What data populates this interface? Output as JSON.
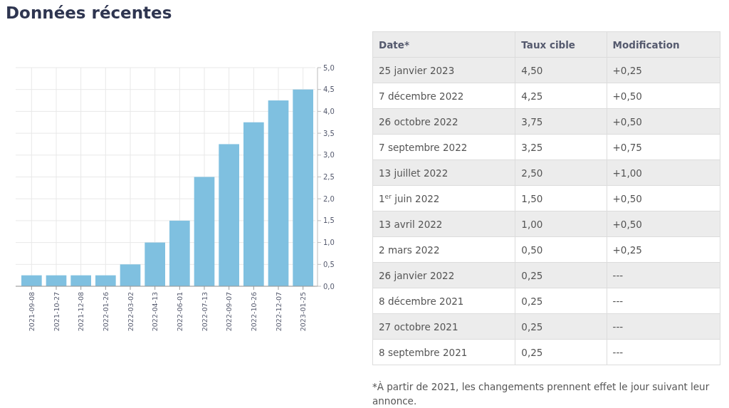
{
  "title": "Données récentes",
  "chart": {
    "chart_data": {
      "type": "bar",
      "categories": [
        "2021-09-08",
        "2021-10-27",
        "2021-12-08",
        "2022-01-26",
        "2022-03-02",
        "2022-04-13",
        "2022-06-01",
        "2022-07-13",
        "2022-09-07",
        "2022-10-26",
        "2022-12-07",
        "2023-01-25"
      ],
      "values": [
        0.25,
        0.25,
        0.25,
        0.25,
        0.5,
        1.0,
        1.5,
        2.5,
        3.25,
        3.75,
        4.25,
        4.5
      ],
      "grid": true,
      "ylim": [
        0,
        5
      ],
      "yticks": [
        {
          "value": 0,
          "label": "0,0"
        },
        {
          "value": 0.5,
          "label": "0,5"
        },
        {
          "value": 1,
          "label": "1,0"
        },
        {
          "value": 1.5,
          "label": "1,5"
        },
        {
          "value": 2,
          "label": "2,0"
        },
        {
          "value": 2.5,
          "label": "2,5"
        },
        {
          "value": 3,
          "label": "3,0"
        },
        {
          "value": 3.5,
          "label": "3,5"
        },
        {
          "value": 4,
          "label": "4,0"
        },
        {
          "value": 4.5,
          "label": "4,5"
        },
        {
          "value": 5,
          "label": "5,0"
        }
      ]
    }
  },
  "table": {
    "columns": [
      "Date*",
      "Taux cible",
      "Modification"
    ],
    "rows": [
      [
        "25 janvier 2023",
        "4,50",
        "+0,25"
      ],
      [
        "7 décembre 2022",
        "4,25",
        "+0,50"
      ],
      [
        "26 octobre 2022",
        "3,75",
        "+0,50"
      ],
      [
        "7 septembre 2022",
        "3,25",
        "+0,75"
      ],
      [
        "13 juillet 2022",
        "2,50",
        "+1,00"
      ],
      [
        "1$^{er}$ juin 2022",
        "1,50",
        "+0,50"
      ],
      [
        "13 avril 2022",
        "1,00",
        "+0,50"
      ],
      [
        "2 mars 2022",
        "0,50",
        "+0,25"
      ],
      [
        "26 janvier 2022",
        "0,25",
        "---"
      ],
      [
        "8 décembre 2021",
        "0,25",
        "---"
      ],
      [
        "27 octobre 2021",
        "0,25",
        "---"
      ],
      [
        "8 septembre 2021",
        "0,25",
        "---"
      ]
    ]
  },
  "footnote": "*À partir de 2021, les changements prennent effet le jour suivant leur annonce."
}
